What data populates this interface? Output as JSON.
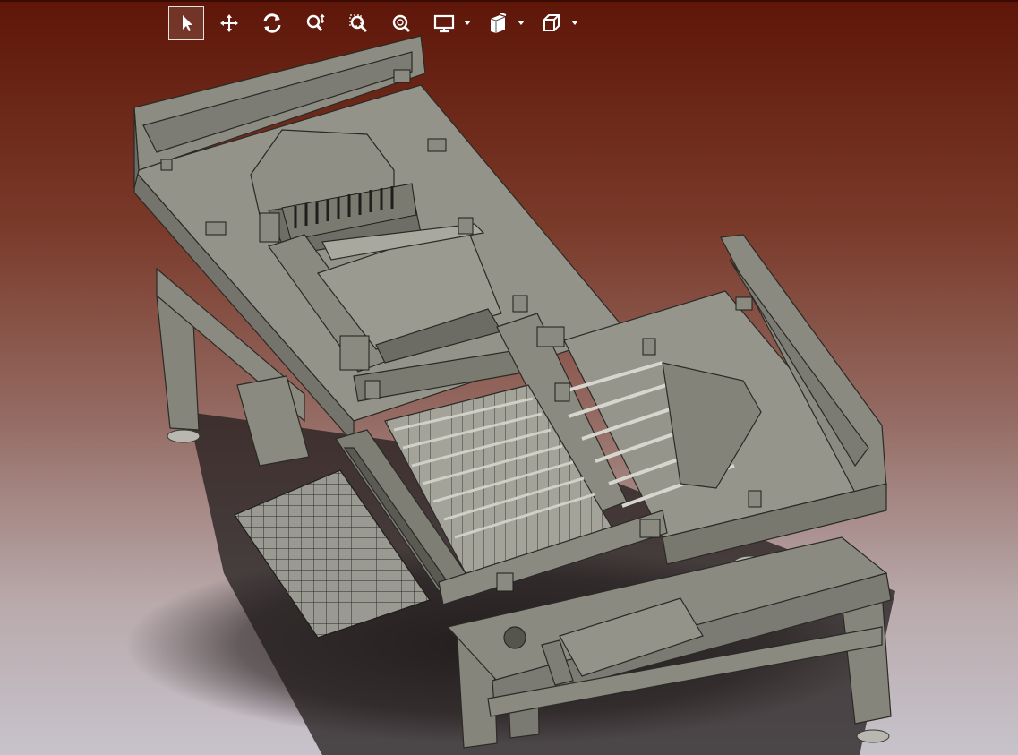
{
  "colors": {
    "bg_top": "#5e1608",
    "bg_bottom": "#c7c3cb",
    "model_body": "#8e8e84",
    "model_edge": "#2a2a26",
    "toolbar_icon": "#ffffff"
  },
  "toolbar": {
    "tools": [
      {
        "icon": "select-arrow-icon",
        "active": true
      },
      {
        "icon": "pan-move-icon",
        "active": false
      },
      {
        "icon": "rotate-icon",
        "active": false
      },
      {
        "icon": "zoom-in-out-icon",
        "active": false
      },
      {
        "icon": "zoom-area-icon",
        "active": false
      },
      {
        "icon": "zoom-fit-icon",
        "active": false
      },
      {
        "icon": "display-mode-icon",
        "dropdown": true
      },
      {
        "icon": "section-view-icon",
        "dropdown": true
      },
      {
        "icon": "view-orientation-cube-icon",
        "dropdown": true
      }
    ]
  }
}
